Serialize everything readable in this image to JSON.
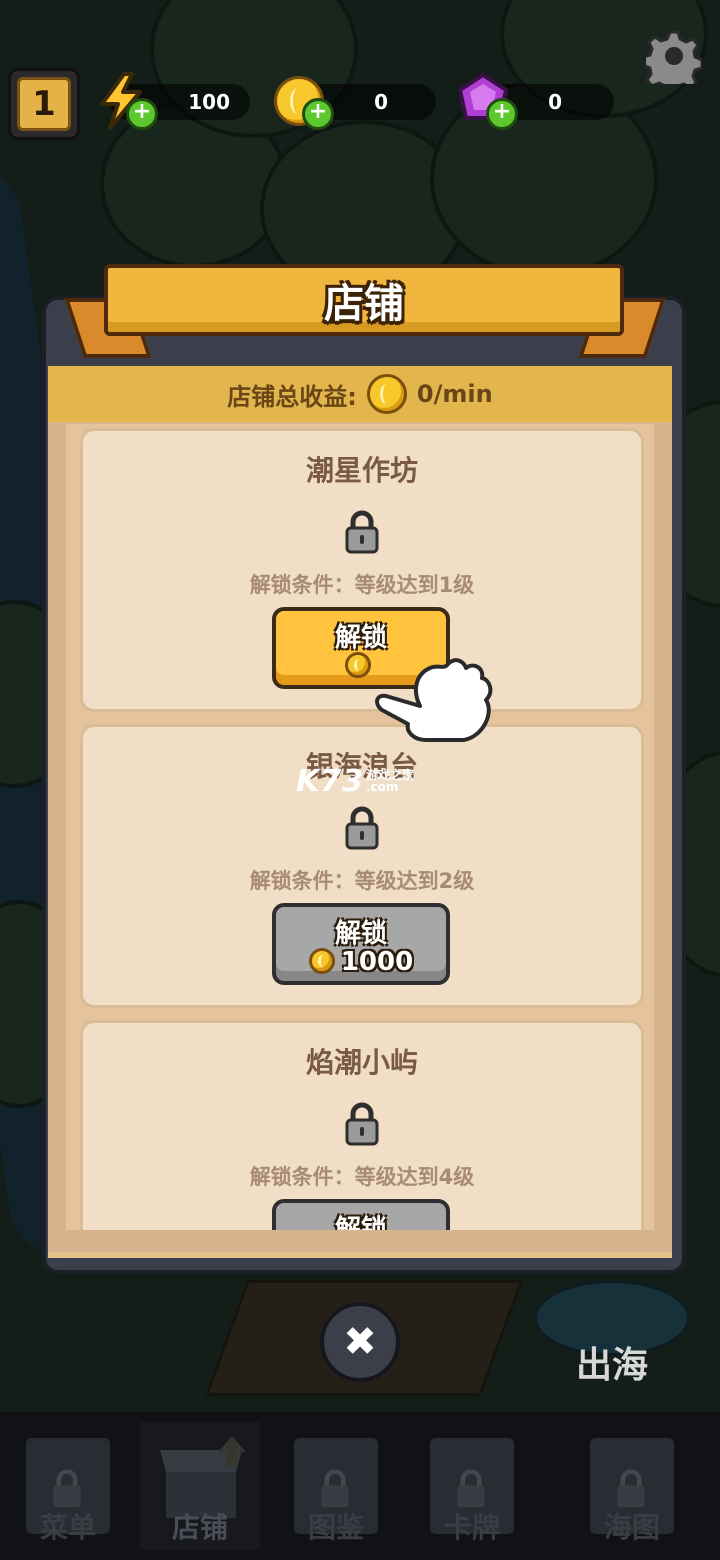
{
  "hud": {
    "level": "1",
    "energy": "100",
    "coins": "0",
    "gems": "0"
  },
  "panel": {
    "title": "店铺",
    "income_label": "店铺总收益:",
    "income_value": "0/min"
  },
  "shops": [
    {
      "name": "潮星作坊",
      "condition": "解锁条件：等级达到1级",
      "button": "解锁",
      "cost": "",
      "state": "available"
    },
    {
      "name": "银海浪台",
      "condition": "解锁条件：等级达到2级",
      "button": "解锁",
      "cost": "1000",
      "state": "locked"
    },
    {
      "name": "焰潮小屿",
      "condition": "解锁条件：等级达到4级",
      "button": "解锁",
      "cost": "",
      "state": "locked"
    }
  ],
  "watermark": {
    "logo": "K73",
    "text": "游戏之家",
    "url": ".com"
  },
  "sea_button": "出海",
  "nav": [
    {
      "label": "菜单",
      "locked": true
    },
    {
      "label": "店铺",
      "locked": false,
      "active": true
    },
    {
      "label": "图鉴",
      "locked": true
    },
    {
      "label": "卡牌",
      "locked": true
    },
    {
      "label": "海图",
      "locked": true
    }
  ],
  "colors": {
    "gold": "#f0b63e",
    "panel": "#3a3f4b",
    "card": "#f0dfc6",
    "button_active": "#ffc33e",
    "button_disabled": "#a7a7a7"
  }
}
